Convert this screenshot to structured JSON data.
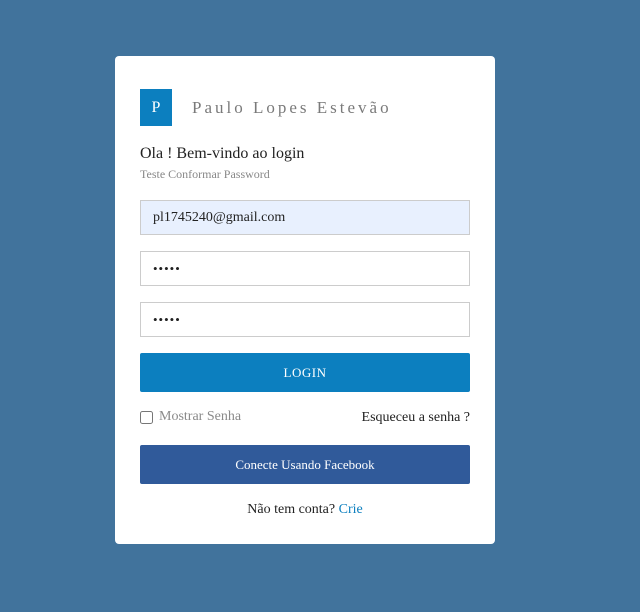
{
  "brand": {
    "logo_letter": "P",
    "name": "Paulo Lopes Estevão"
  },
  "header": {
    "welcome": "Ola ! Bem-vindo ao login",
    "subtitle": "Teste Conformar Password"
  },
  "form": {
    "email_value": "pl1745240@gmail.com",
    "password_value": "•••••",
    "confirm_password_value": "•••••",
    "login_label": "LOGIN",
    "show_password_label": "Mostrar Senha",
    "forgot_password_label": "Esqueceu a senha ?",
    "facebook_label": "Conecte Usando Facebook",
    "no_account_text": "Não tem conta?",
    "signup_link": "Crie"
  },
  "colors": {
    "background": "#41739c",
    "accent": "#0c7fbf",
    "facebook": "#305a9a"
  }
}
